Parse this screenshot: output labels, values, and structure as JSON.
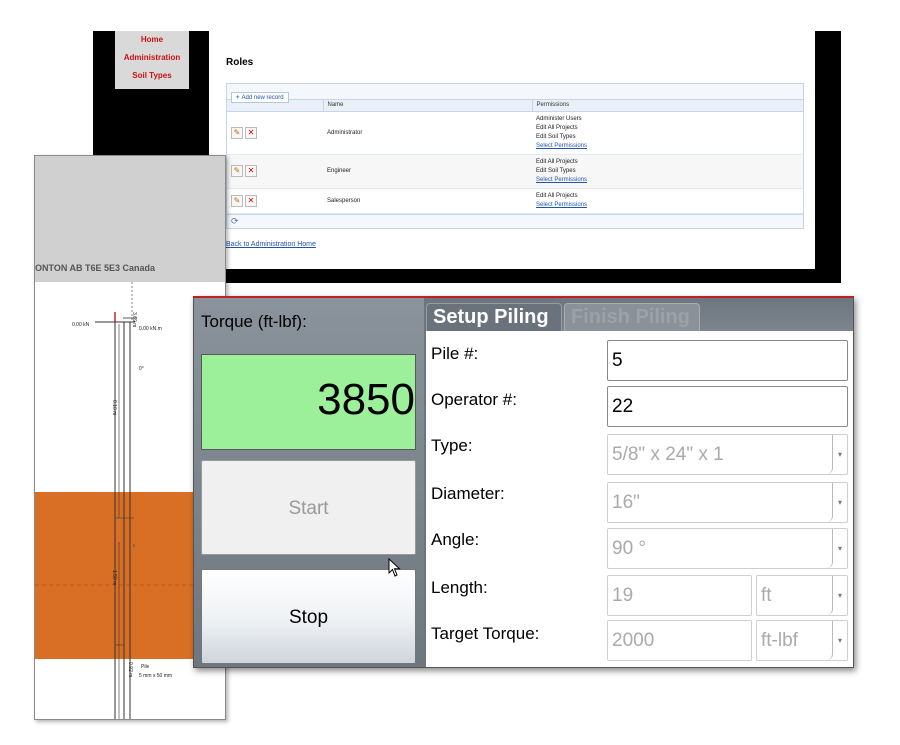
{
  "admin": {
    "nav": [
      "Home",
      "Administration",
      "Soil Types"
    ],
    "page_title": "Roles",
    "add_button": "Add new record",
    "columns": [
      "Name",
      "Permissions"
    ],
    "rows": [
      {
        "name": "Administrator",
        "permissions": [
          "Administer Users",
          "Edit All Projects",
          "Edit Soil Types"
        ],
        "link": "Select Permissions"
      },
      {
        "name": "Engineer",
        "permissions": [
          "Edit All Projects",
          "Edit Soil Types"
        ],
        "link": "Select Permissions"
      },
      {
        "name": "Salesperson",
        "permissions": [
          "Edit All Projects"
        ],
        "link": "Select Permissions"
      }
    ],
    "back_link": "Back to Administration Home"
  },
  "drawing": {
    "address": "ONTON AB T6E 5E3 Canada",
    "load_left": "0.00 kN",
    "load_right": "0.00 kN.m",
    "top_dim": "3.69 m",
    "angle": "0°",
    "dim_upper": "0.10 m",
    "dim_mid": "1.50 m",
    "dim_bottom": "0.92 m",
    "pile_label": "Pile",
    "pile_size": "5 mm x 50 mm",
    "soil_color": "#d96f24"
  },
  "control": {
    "torque_label": "Torque (ft-lbf):",
    "torque_value": "3850",
    "start_label": "Start",
    "stop_label": "Stop",
    "tabs": [
      "Setup Piling",
      "Finish Piling"
    ],
    "active_tab": "Setup Piling",
    "fields": {
      "pile_label": "Pile #:",
      "pile_value": "5",
      "operator_label": "Operator #:",
      "operator_value": "22",
      "type_label": "Type:",
      "type_value": "5/8\" x 24\" x 1",
      "diameter_label": "Diameter:",
      "diameter_value": "16\"",
      "angle_label": "Angle:",
      "angle_value": "90 °",
      "length_label": "Length:",
      "length_value": "19",
      "length_unit": "ft",
      "target_label": "Target Torque:",
      "target_value": "2000",
      "target_unit": "ft-lbf"
    }
  }
}
